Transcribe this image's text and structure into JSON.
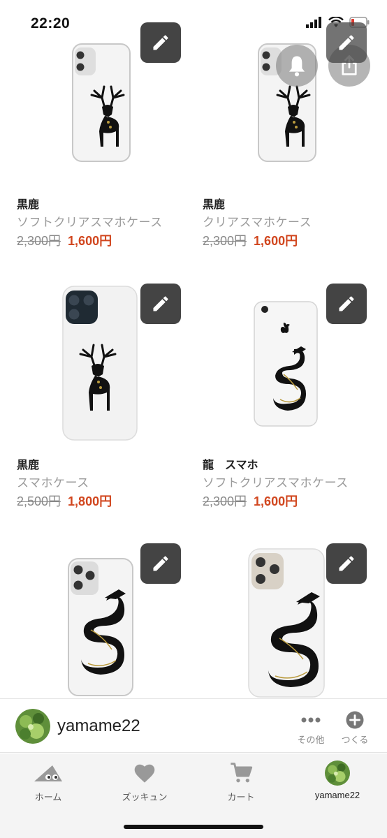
{
  "status_bar": {
    "time": "22:20"
  },
  "products": [
    {
      "title": "黒鹿",
      "type": "ソフトクリアスマホケース",
      "old_price": "2,300円",
      "new_price": "1,600円"
    },
    {
      "title": "黒鹿",
      "type": "クリアスマホケース",
      "old_price": "2,300円",
      "new_price": "1,600円"
    },
    {
      "title": "黒鹿",
      "type": "スマホケース",
      "old_price": "2,500円",
      "new_price": "1,800円"
    },
    {
      "title": "龍　スマホ",
      "type": "ソフトクリアスマホケース",
      "old_price": "2,300円",
      "new_price": "1,600円"
    },
    {
      "title": "",
      "type": "",
      "old_price": "",
      "new_price": ""
    },
    {
      "title": "",
      "type": "",
      "old_price": "",
      "new_price": ""
    }
  ],
  "user_bar": {
    "username": "yamame22",
    "more_label": "その他",
    "create_label": "つくる"
  },
  "tabs": [
    {
      "label": "ホーム",
      "icon": "home-mountain-icon"
    },
    {
      "label": "ズッキュン",
      "icon": "heart-icon"
    },
    {
      "label": "カート",
      "icon": "cart-icon"
    },
    {
      "label": "yamame22",
      "icon": "avatar"
    }
  ],
  "colors": {
    "sale_price": "#d1461e",
    "edit_button": "#444444",
    "text_muted": "#9a9a9a"
  }
}
